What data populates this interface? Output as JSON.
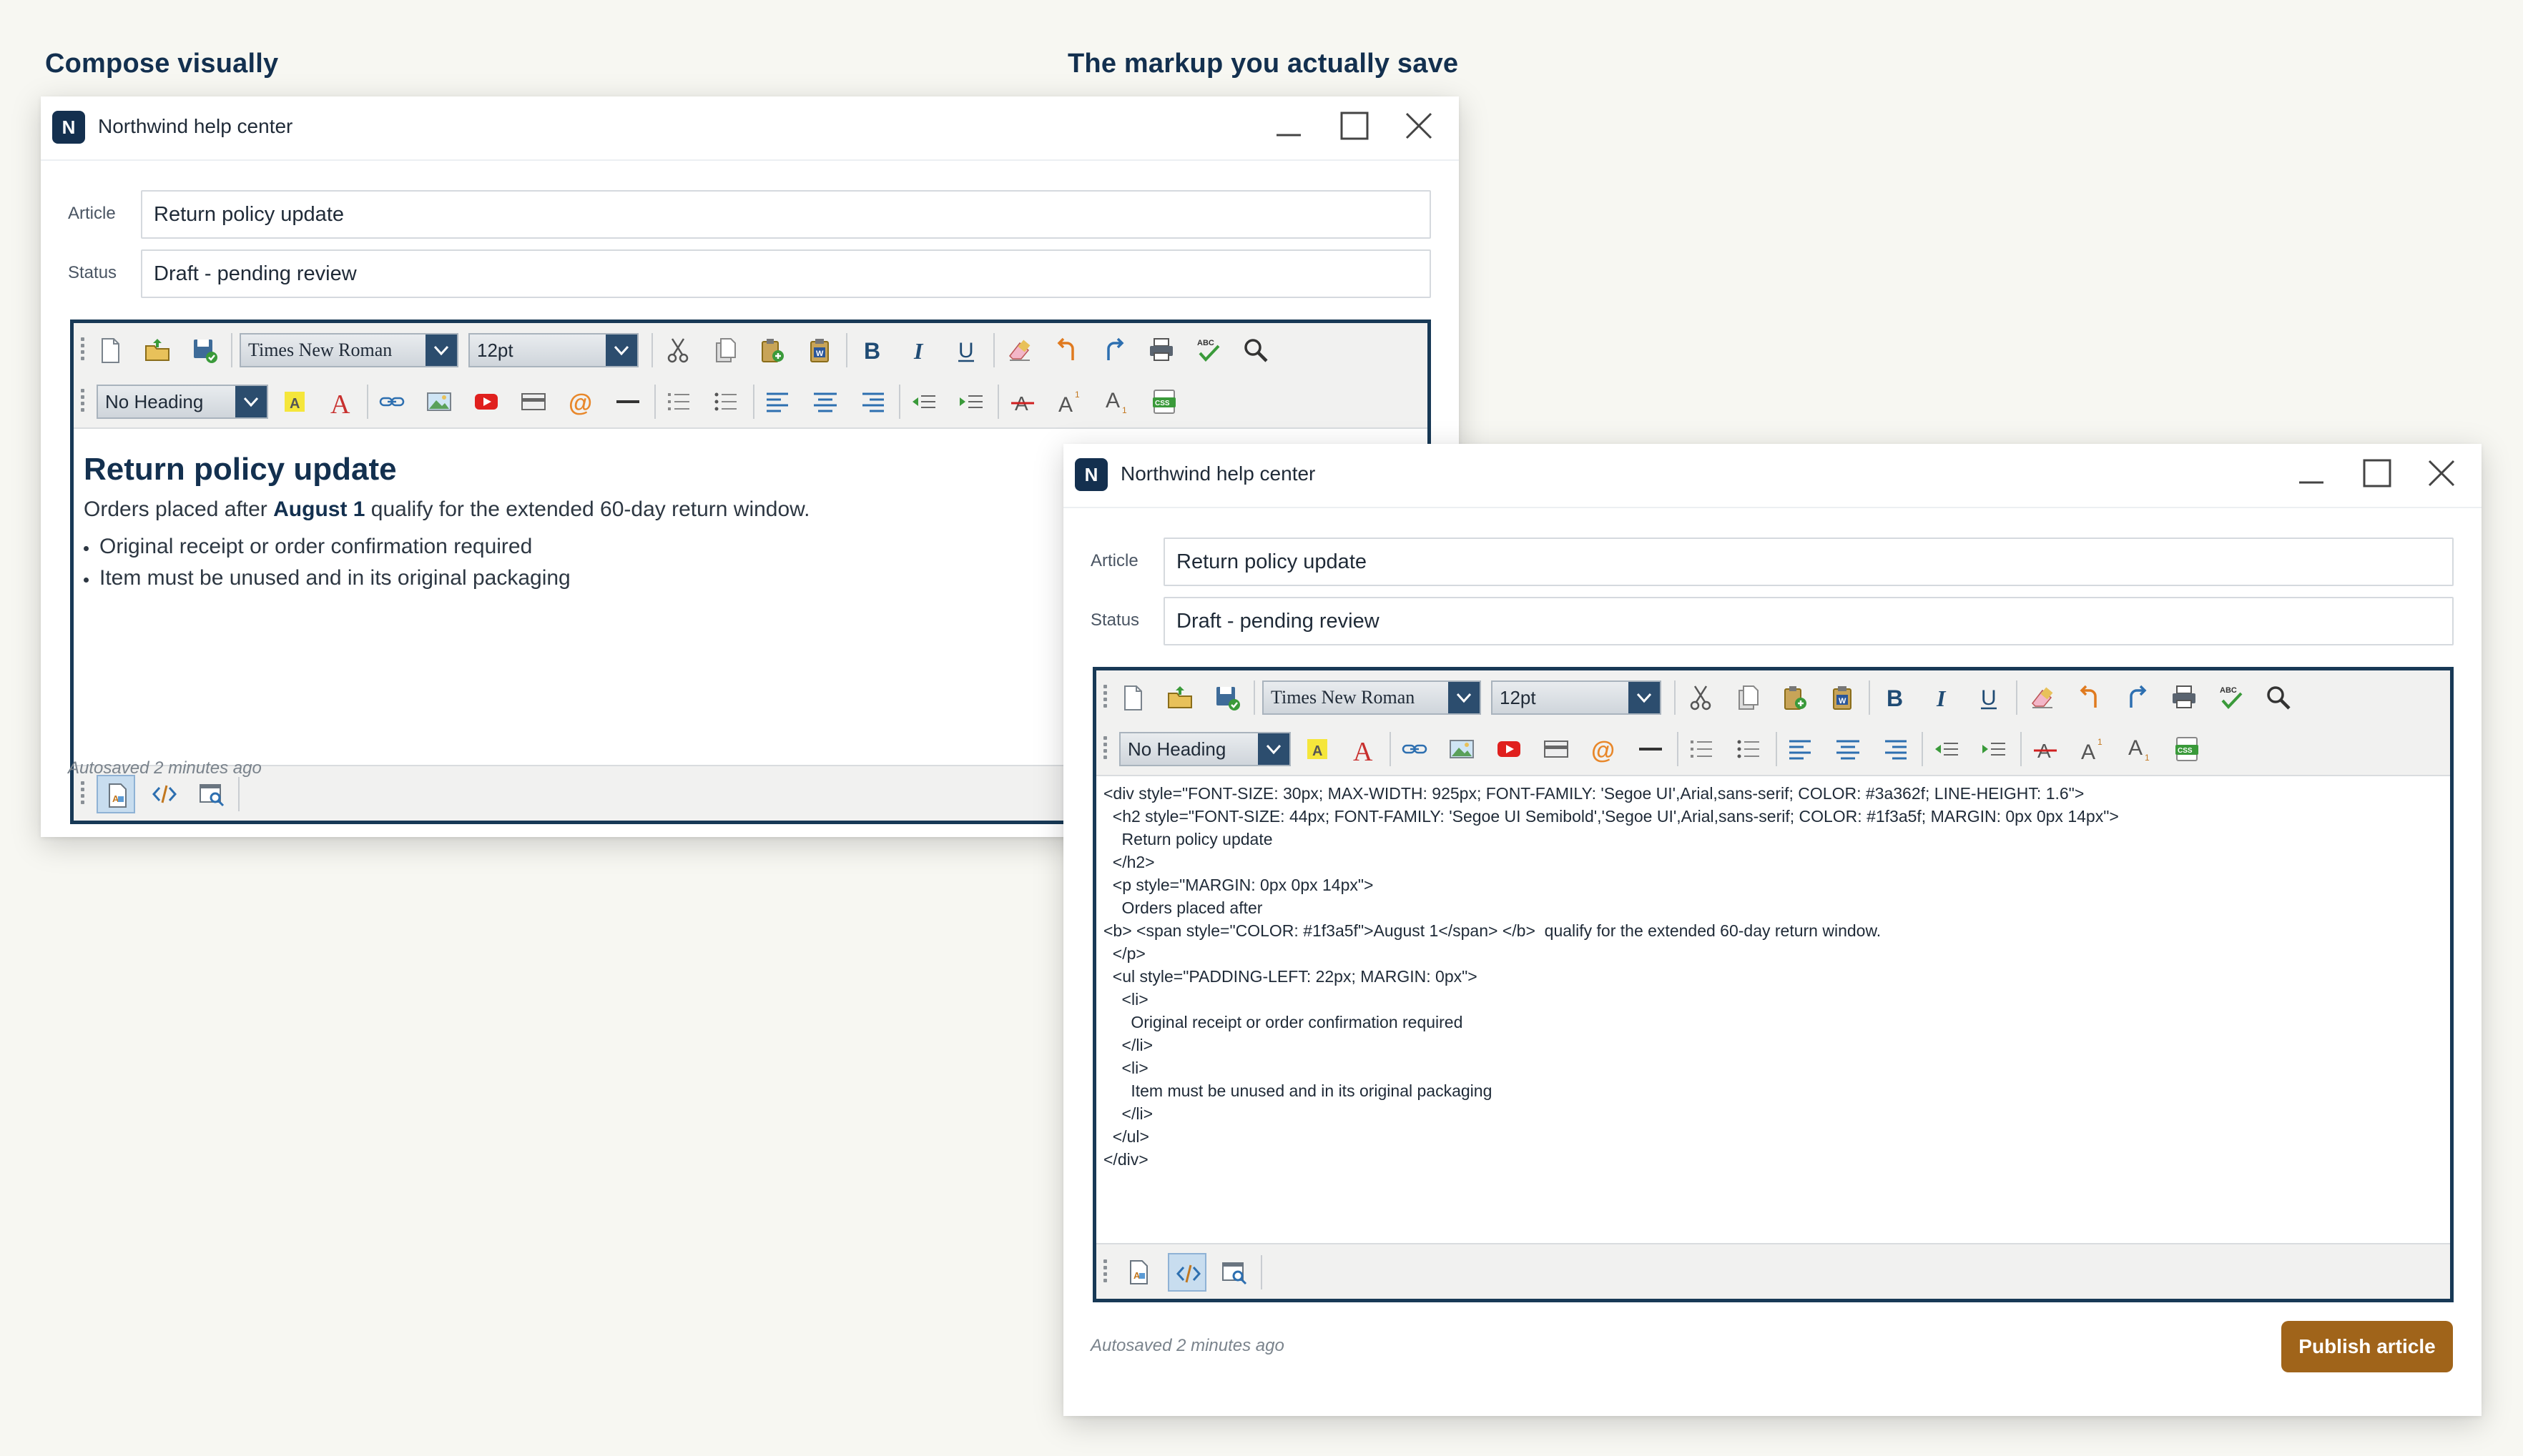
{
  "headings": {
    "left": "Compose visually",
    "right": "The markup you actually save"
  },
  "colors": {
    "brand_navy": "#14304f",
    "editor_border": "#183956",
    "publish_button": "#a0641a",
    "page_background": "#f7f7f2"
  },
  "window": {
    "logo_letter": "N",
    "title": "Northwind help center",
    "controls": [
      "minimize-icon",
      "maximize-icon",
      "close-icon"
    ]
  },
  "form": {
    "article_label": "Article",
    "article_value": "Return policy update",
    "status_label": "Status",
    "status_value": "Draft - pending review"
  },
  "toolbar": {
    "font_family": "Times New Roman",
    "font_size": "12pt",
    "heading": "No Heading",
    "row1_icons": [
      "new-document-icon",
      "open-folder-icon",
      "save-icon",
      "cut-icon",
      "copy-icon",
      "paste-icon",
      "paste-from-word-icon",
      "bold-icon",
      "italic-icon",
      "underline-icon",
      "clear-format-icon",
      "undo-icon",
      "redo-icon",
      "print-icon",
      "spellcheck-icon",
      "find-icon"
    ],
    "row2_icons": [
      "highlight-icon",
      "font-color-icon",
      "link-icon",
      "image-icon",
      "video-icon",
      "table-icon",
      "email-icon",
      "horizontal-rule-icon",
      "ordered-list-icon",
      "unordered-list-icon",
      "align-left-icon",
      "align-center-icon",
      "align-right-icon",
      "outdent-icon",
      "indent-icon",
      "strikethrough-icon",
      "superscript-icon",
      "subscript-icon",
      "css-icon"
    ],
    "bold_glyph": "B",
    "italic_glyph": "I",
    "underline_glyph": "U",
    "spell_text": "ABC",
    "css_text": "CSS"
  },
  "document": {
    "heading": "Return policy update",
    "para_before": "Orders placed after ",
    "para_bold": "August 1",
    "para_after": " qualify for the extended 60-day return window.",
    "items": [
      "Original receipt or order confirmation required",
      "Item must be unused and in its original packaging"
    ]
  },
  "source_lines": [
    "<div style=\"FONT-SIZE: 30px; MAX-WIDTH: 925px; FONT-FAMILY: 'Segoe UI',Arial,sans-serif; COLOR: #3a362f; LINE-HEIGHT: 1.6\">",
    "  <h2 style=\"FONT-SIZE: 44px; FONT-FAMILY: 'Segoe UI Semibold','Segoe UI',Arial,sans-serif; COLOR: #1f3a5f; MARGIN: 0px 0px 14px\">",
    "    Return policy update",
    "  </h2>",
    "  <p style=\"MARGIN: 0px 0px 14px\">",
    "    Orders placed after",
    "<b> <span style=\"COLOR: #1f3a5f\">August 1</span> </b>  qualify for the extended 60-day return window.",
    "  </p>",
    "  <ul style=\"PADDING-LEFT: 22px; MARGIN: 0px\">",
    "    <li>",
    "      Original receipt or order confirmation required",
    "    </li>",
    "    <li>",
    "      Item must be unused and in its original packaging",
    "    </li>",
    "  </ul>",
    "</div>"
  ],
  "footer": {
    "autosave": "Autosaved 2 minutes ago",
    "publish_label": "Publish article"
  }
}
